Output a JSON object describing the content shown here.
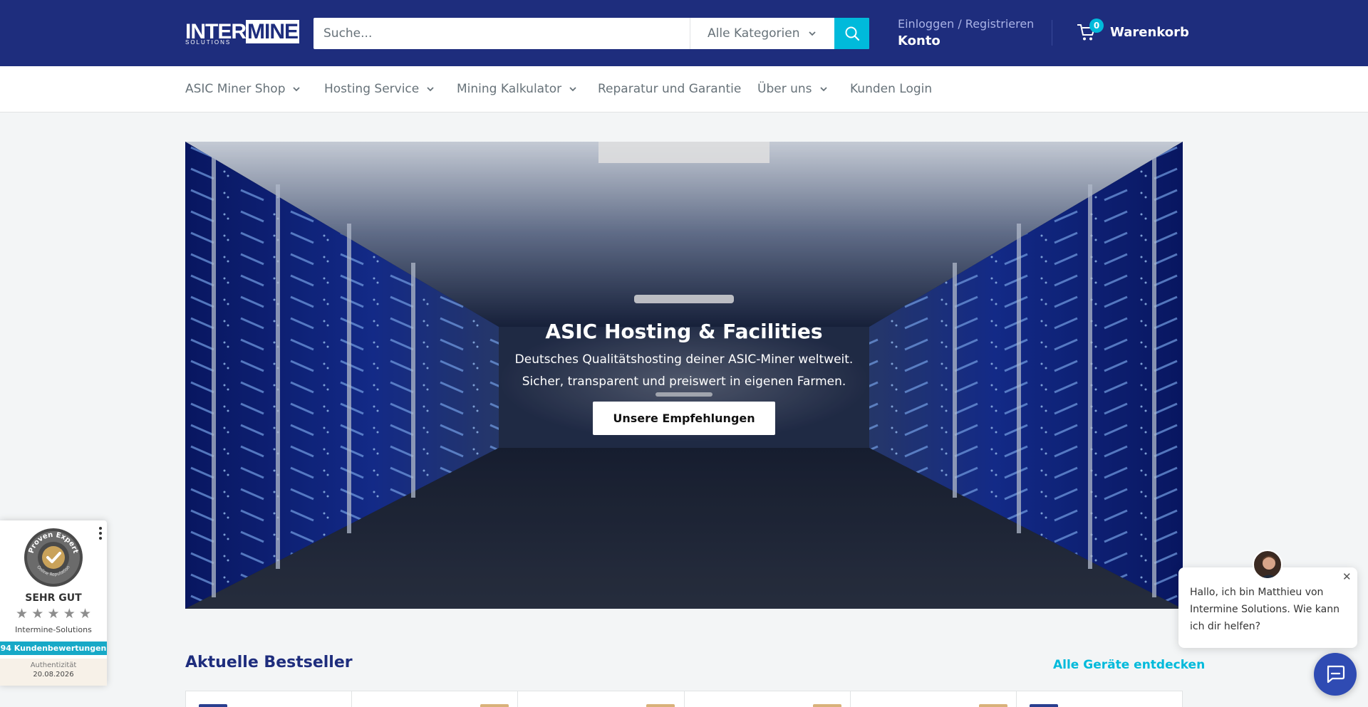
{
  "header": {
    "logo_main_a": "INTER",
    "logo_main_b": "MINE",
    "logo_sub": "SOLUTIONS",
    "search_placeholder": "Suche...",
    "category_label": "Alle Kategorien",
    "login_label": "Einloggen / Registrieren",
    "account_label": "Konto",
    "cart_count": "0",
    "cart_label": "Warenkorb"
  },
  "nav": {
    "items": [
      {
        "label": "ASIC Miner Shop"
      },
      {
        "label": "Hosting Service"
      },
      {
        "label": "Mining Kalkulator"
      },
      {
        "label": "Reparatur und Garantie"
      },
      {
        "label": "Über uns"
      },
      {
        "label": "Kunden Login"
      }
    ]
  },
  "hero": {
    "title": "ASIC Hosting & Facilities",
    "subtitle_line1": "Deutsches Qualitätshosting deiner ASIC-Miner weltweit.",
    "subtitle_line2": "Sicher, transparent und preiswert in eigenen Farmen.",
    "button_label": "Unsere Empfehlungen"
  },
  "bestseller": {
    "title": "Aktuelle Bestseller",
    "link_label": "Alle Geräte entdecken"
  },
  "proven_expert": {
    "rating_label": "SEHR GUT",
    "company": "Intermine-Solutions",
    "reviews": "94 Kundenbewertungen",
    "auth_label": "Authentizität",
    "auth_date": "20.08.2026",
    "stars": 5,
    "badge_text_top": "Proven Expert",
    "badge_text_bottom": "Online Reputation"
  },
  "chat": {
    "message": "Hallo, ich bin Matthieu von Intermine Solutions. Wie kann ich dir helfen?",
    "close_symbol": "✕"
  },
  "colors": {
    "brand_navy": "#1e2d7d",
    "accent_cyan": "#00badb",
    "chat_blue": "#2f4bb3"
  }
}
